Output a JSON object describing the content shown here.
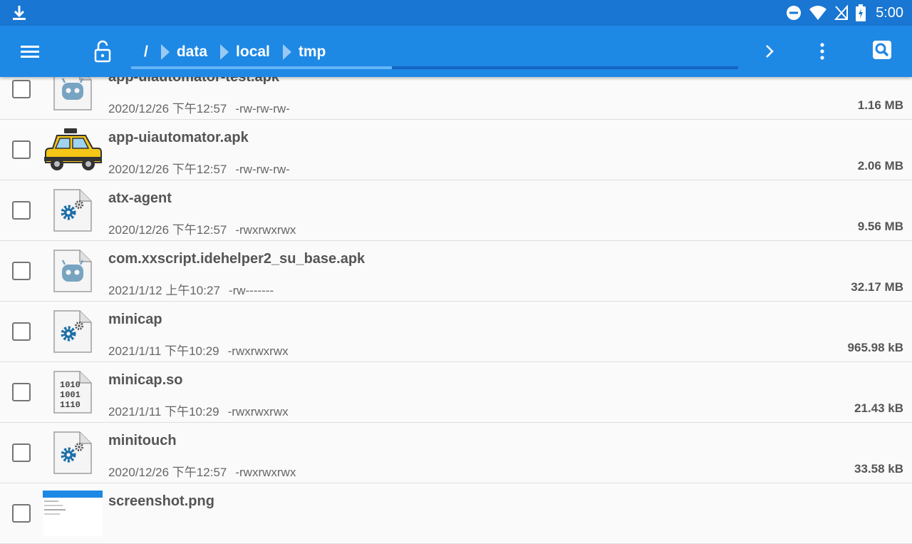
{
  "statusbar": {
    "time": "5:00"
  },
  "toolbar": {
    "breadcrumbs": [
      "/",
      "data",
      "local",
      "tmp"
    ],
    "progress": 0.43
  },
  "files": [
    {
      "name": "app-uiautomator-test.apk",
      "date": "2020/12/26 下午12:57",
      "perm": "-rw-rw-rw-",
      "size": "1.16 MB",
      "icon": "android-apk-icon"
    },
    {
      "name": "app-uiautomator.apk",
      "date": "2020/12/26 下午12:57",
      "perm": "-rw-rw-rw-",
      "size": "2.06 MB",
      "icon": "taxi-app-icon"
    },
    {
      "name": "atx-agent",
      "date": "2020/12/26 下午12:57",
      "perm": "-rwxrwxrwx",
      "size": "9.56 MB",
      "icon": "executable-file-icon"
    },
    {
      "name": "com.xxscript.idehelper2_su_base.apk",
      "date": "2021/1/12 上午10:27",
      "perm": "-rw-------",
      "size": "32.17 MB",
      "icon": "android-apk-icon"
    },
    {
      "name": "minicap",
      "date": "2021/1/11 下午10:29",
      "perm": "-rwxrwxrwx",
      "size": "965.98 kB",
      "icon": "executable-file-icon"
    },
    {
      "name": "minicap.so",
      "date": "2021/1/11 下午10:29",
      "perm": "-rwxrwxrwx",
      "size": "21.43 kB",
      "icon": "binary-file-icon"
    },
    {
      "name": "minitouch",
      "date": "2020/12/26 下午12:57",
      "perm": "-rwxrwxrwx",
      "size": "33.58 kB",
      "icon": "executable-file-icon"
    },
    {
      "name": "screenshot.png",
      "date": "",
      "perm": "",
      "size": "",
      "icon": "image-thumbnail"
    }
  ],
  "binary_icon_text": [
    "1010",
    "1001",
    "1110"
  ],
  "colors": {
    "statusbar": "#1976d2",
    "toolbar": "#1e88e5",
    "accent": "#64b5f6"
  }
}
